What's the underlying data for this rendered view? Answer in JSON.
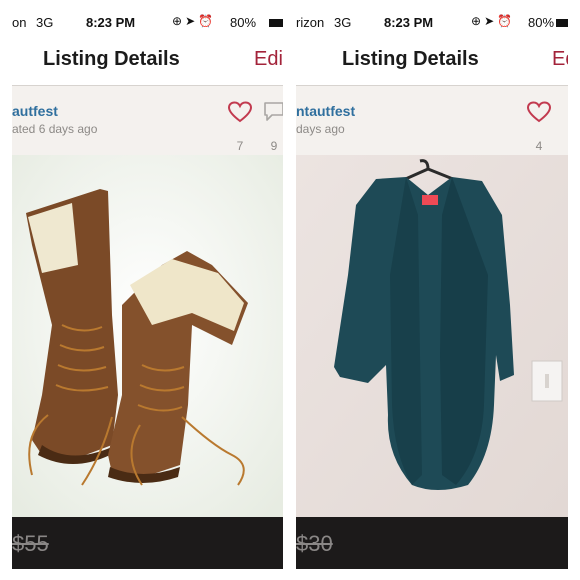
{
  "left": {
    "status": {
      "carrier": "on",
      "network": "3G",
      "time": "8:23 PM",
      "battery": "80%"
    },
    "nav": {
      "title": "Listing Details",
      "edit_label": "Edit"
    },
    "seller": {
      "name": "autfest",
      "posted": "ated 6 days ago"
    },
    "likes": "7",
    "comments": "9",
    "price": "$55"
  },
  "right": {
    "status": {
      "carrier": "rizon",
      "network": "3G",
      "time": "8:23 PM",
      "battery": "80%"
    },
    "nav": {
      "title": "Listing Details",
      "edit_label": "Ed"
    },
    "seller": {
      "name": "ntautfest",
      "posted": "days ago"
    },
    "likes": "4",
    "price": "$30"
  },
  "colors": {
    "accent": "#a3233a",
    "seller_link": "#2f6f9e",
    "price_bar": "#1c1a1a"
  },
  "icons": [
    "heart-icon",
    "comment-bubble-icon",
    "location-arrow-icon",
    "alarm-icon",
    "rotation-lock-icon",
    "battery-icon"
  ]
}
